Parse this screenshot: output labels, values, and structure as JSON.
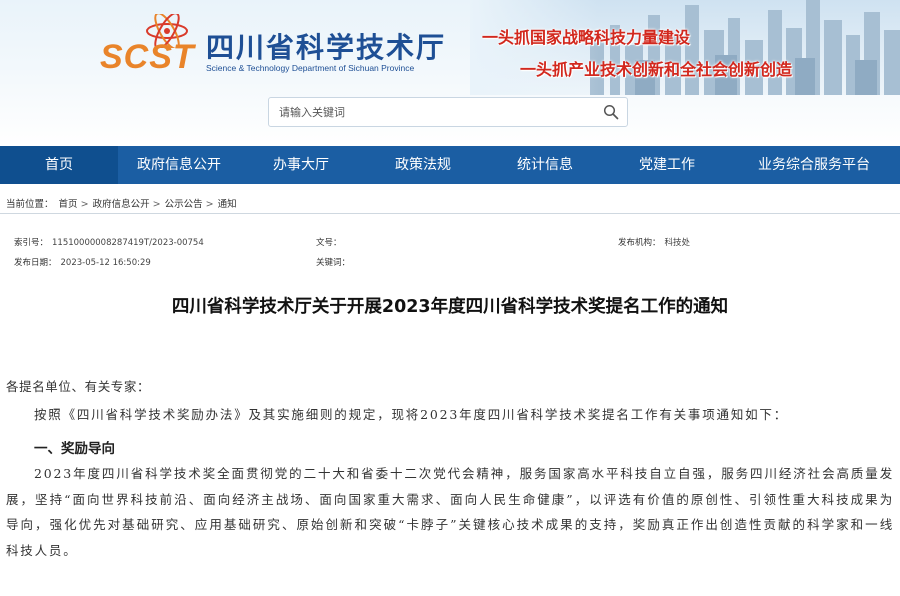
{
  "header": {
    "logo_abbr": "SCST",
    "site_title": "四川省科学技术厅",
    "site_subtitle": "Science & Technology Department of Sichuan Province",
    "slogan_1": "一头抓国家战略科技力量建设",
    "slogan_2": "一头抓产业技术创新和全社会创新创造"
  },
  "search": {
    "placeholder": "请输入关键词"
  },
  "nav": {
    "items": [
      {
        "label": "首页"
      },
      {
        "label": "政府信息公开"
      },
      {
        "label": "办事大厅"
      },
      {
        "label": "政策法规"
      },
      {
        "label": "统计信息"
      },
      {
        "label": "党建工作"
      },
      {
        "label": "业务综合服务平台"
      }
    ]
  },
  "breadcrumb": {
    "prefix": "当前位置：",
    "items": [
      "首页",
      "政府信息公开",
      "公示公告",
      "通知"
    ],
    "separator": ">"
  },
  "meta": {
    "index_label": "索引号：",
    "index_value": "11510000008287419T/2023-00754",
    "doc_no_label": "文号：",
    "doc_no_value": "",
    "publisher_label": "发布机构：",
    "publisher_value": "科技处",
    "date_label": "发布日期：",
    "date_value": "2023-05-12 16:50:29",
    "keywords_label": "关键词：",
    "keywords_value": ""
  },
  "article": {
    "title": "四川省科学技术厅关于开展2023年度四川省科学技术奖提名工作的通知",
    "salutation": "各提名单位、有关专家：",
    "intro": "按照《四川省科学技术奖励办法》及其实施细则的规定，现将2023年度四川省科学技术奖提名工作有关事项通知如下：",
    "section_1_heading": "一、奖励导向",
    "section_1_text": "2023年度四川省科学技术奖全面贯彻党的二十大和省委十二次党代会精神，服务国家高水平科技自立自强，服务四川经济社会高质量发展，坚持“面向世界科技前沿、面向经济主战场、面向国家重大需求、面向人民生命健康”，以评选有价值的原创性、引领性重大科技成果为导向，强化优先对基础研究、应用基础研究、原始创新和突破“卡脖子”关键核心技术成果的支持，奖励真正作出创造性贡献的科学家和一线科技人员。"
  },
  "colors": {
    "nav_bg": "#1b5ea3",
    "brand_blue": "#1e4f95",
    "logo_orange": "#e9842a",
    "slogan_red": "#d2281e"
  },
  "icons": [
    "atom-logo-icon",
    "search-icon"
  ]
}
